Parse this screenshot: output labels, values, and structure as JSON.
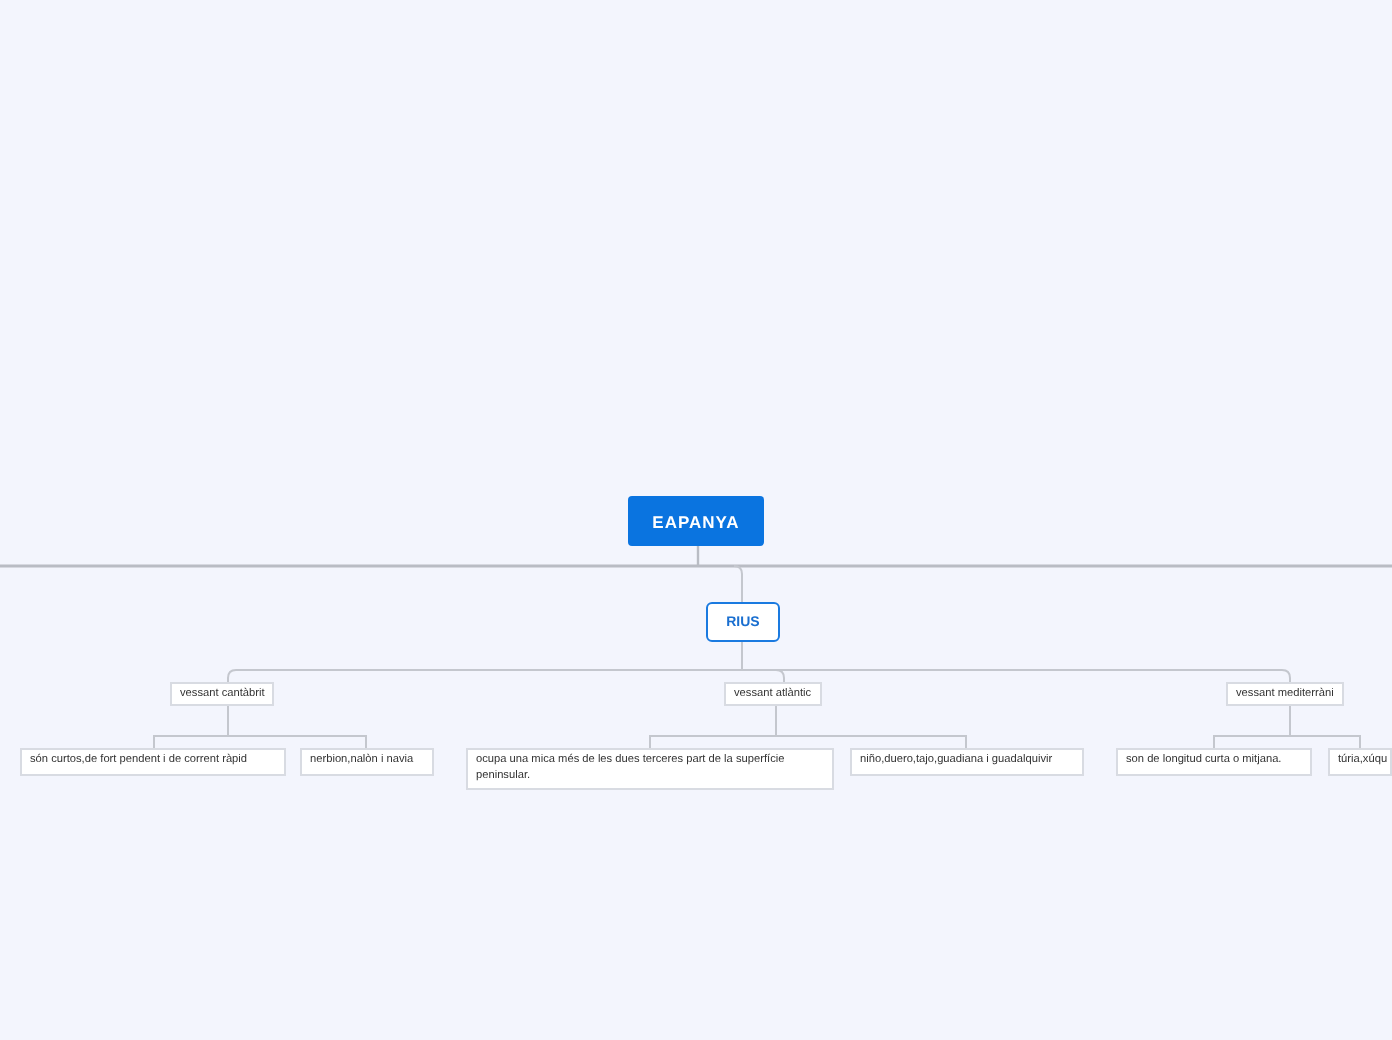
{
  "root": {
    "title": "EAPANYA",
    "children": [
      {
        "title": "RIUS",
        "children": [
          {
            "title": "vessant cantàbrit",
            "children": [
              {
                "title": "són curtos,de fort pendent i de corrent ràpid"
              },
              {
                "title": "nerbion,nalòn i navia"
              }
            ]
          },
          {
            "title": "vessant atlàntic",
            "children": [
              {
                "title": "ocupa una mica més de les dues terceres part de la superfície peninsular."
              },
              {
                "title": "niño,duero,tajo,guadiana i guadalquivir"
              }
            ]
          },
          {
            "title": "vessant mediterràni",
            "children": [
              {
                "title": "son de longitud curta o mitjana."
              },
              {
                "title": "túria,xúqu"
              }
            ]
          }
        ]
      }
    ]
  }
}
